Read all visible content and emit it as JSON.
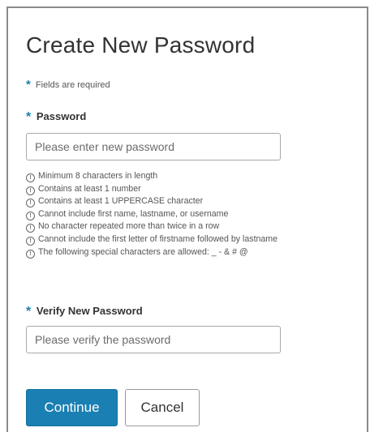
{
  "form": {
    "title": "Create New Password",
    "required_star": "*",
    "required_note": "Fields are required"
  },
  "password": {
    "label": "Password",
    "placeholder": "Please enter new password",
    "value": ""
  },
  "rules": {
    "icon": "info-circle-icon",
    "items": [
      "Minimum 8 characters in length",
      "Contains at least 1 number",
      "Contains at least 1 UPPERCASE character",
      "Cannot include first name, lastname, or username",
      "No character repeated more than twice in a row",
      "Cannot include the first letter of firstname followed by lastname",
      "The following special characters are allowed: _ - & # @"
    ]
  },
  "verify": {
    "label": "Verify New Password",
    "placeholder": "Please verify the password",
    "value": ""
  },
  "buttons": {
    "continue_label": "Continue",
    "cancel_label": "Cancel"
  },
  "colors": {
    "accent": "#1a7fb3",
    "star": "#1e7fb1",
    "text": "#333333"
  }
}
